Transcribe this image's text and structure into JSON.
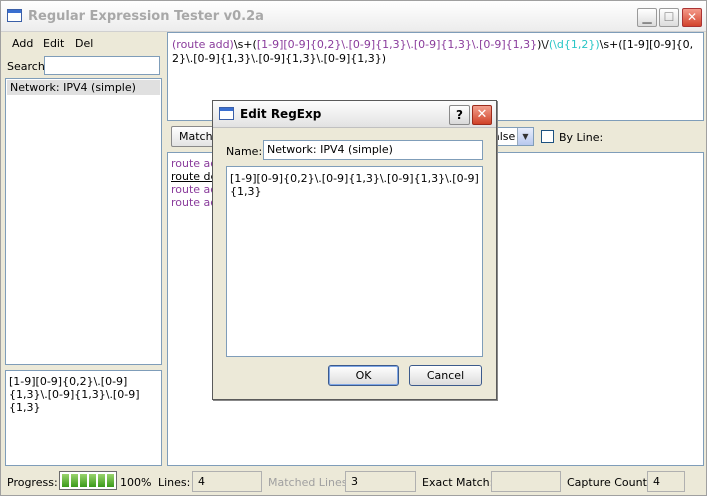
{
  "window": {
    "title": "Regular Expression Tester v0.2a",
    "min_glyph": "▁",
    "max_glyph": "☐",
    "close_glyph": "✕"
  },
  "sidebar": {
    "menu": [
      "Add",
      "Edit",
      "Del"
    ],
    "search_label": "Search:",
    "search_value": "",
    "items": [
      {
        "label": "Network: IPV4 (simple)",
        "selected": true
      }
    ],
    "preview_text": "[1-9][0-9]{0,2}\\.[0-9]{1,3}\\.[0-9]{1,3}\\.[0-9]{1,3}"
  },
  "regex": {
    "segments": [
      {
        "text": "(route add)",
        "color": "purple"
      },
      {
        "text": "\\s+(",
        "color": "dark"
      },
      {
        "text": "[1-9][0-9]{0,2}\\.[0-9]{1,3}\\.[0-9]{1,3}\\.[0-9]{1,3}",
        "color": "purple"
      },
      {
        "text": ")\\/",
        "color": "dark"
      },
      {
        "text": "(\\d{1,2})",
        "color": "cyan"
      },
      {
        "text": "\\s+([1-9][0-9]{0,2}\\.[0-9]{1,3}\\.[0-9]{1,3}\\.[0-9]{1,3})",
        "color": "dark"
      }
    ]
  },
  "toolbar": {
    "match_label": "Match",
    "select_value": "alse",
    "byline_label": "By Line:",
    "byline_checked": false
  },
  "results": [
    {
      "text": "route ac",
      "color": "#8a3c9c"
    },
    {
      "text": "route de",
      "color": "#000000"
    },
    {
      "text": "route ac",
      "color": "#8a3c9c"
    },
    {
      "text": "route ac",
      "color": "#8a3c9c"
    }
  ],
  "status": {
    "progress_label": "Progress:",
    "progress_percent": 100,
    "progress_text": "100%",
    "lines_label": "Lines:",
    "lines_value": "4",
    "matched_label": "Matched Lines:",
    "matched_value": "3",
    "exact_label": "Exact Match:",
    "exact_value": "",
    "capture_label": "Capture Count:",
    "capture_value": "4"
  },
  "dialog": {
    "title": "Edit RegExp",
    "help_glyph": "?",
    "close_glyph": "✕",
    "name_label": "Name:",
    "name_value": "Network: IPV4 (simple)",
    "regex_text": "[1-9][0-9]{0,2}\\.[0-9]{1,3}\\.[0-9]{1,3}\\.[0-9]{1,3}",
    "ok_label": "OK",
    "cancel_label": "Cancel"
  }
}
